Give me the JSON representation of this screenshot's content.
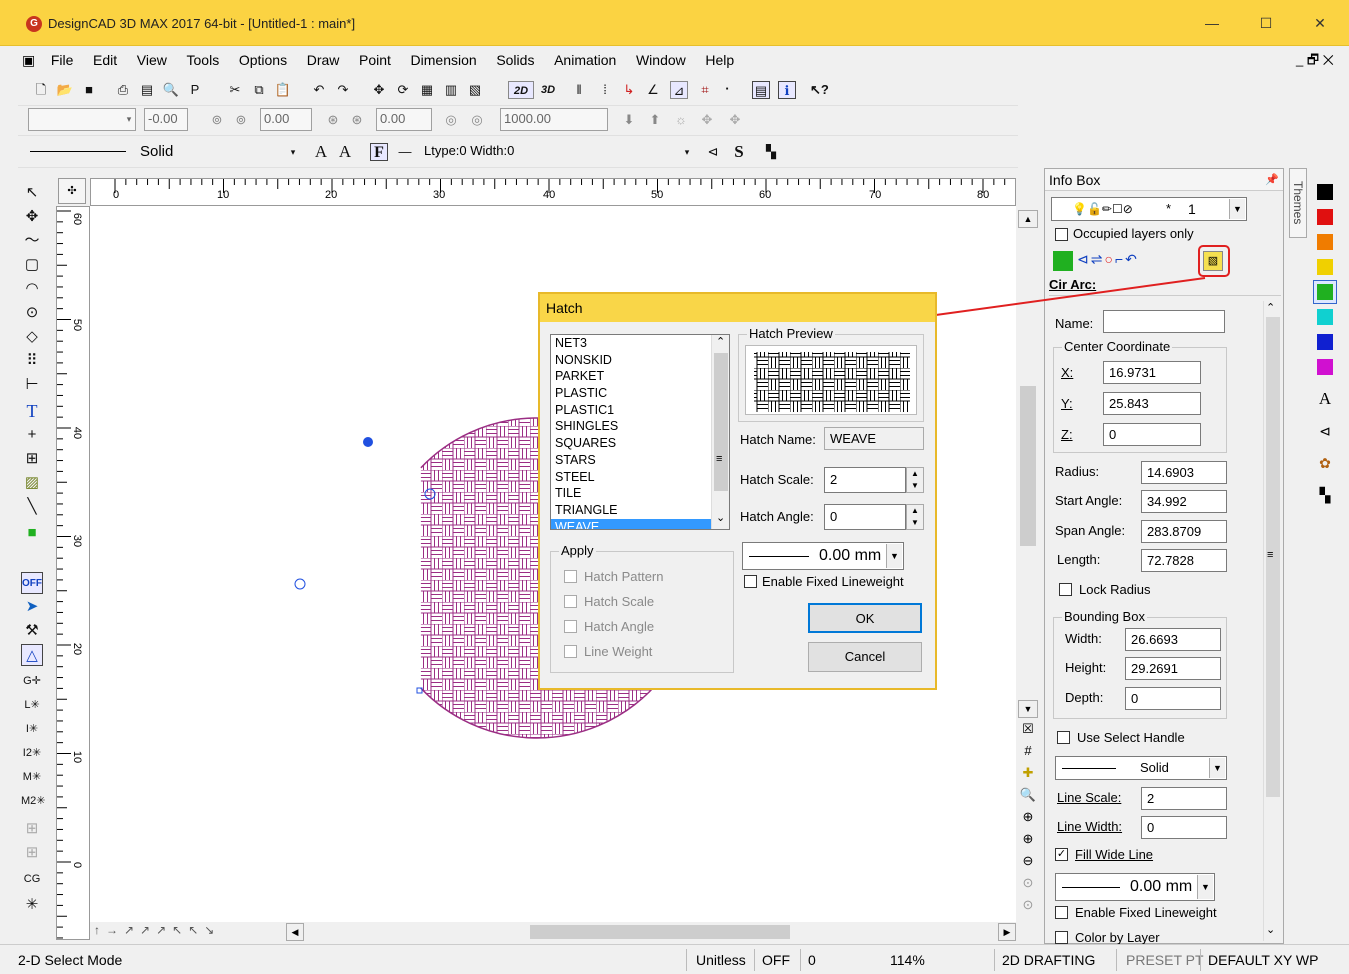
{
  "window": {
    "title": "DesignCAD 3D MAX 2017 64-bit - [Untitled-1 : main*]",
    "app_icon": "designcad-logo-icon",
    "min": "—",
    "max": "☐",
    "close": "✕",
    "mdi_controls": "_ 🗗 ✕"
  },
  "menu": [
    "File",
    "Edit",
    "View",
    "Tools",
    "Options",
    "Draw",
    "Point",
    "Dimension",
    "Solids",
    "Animation",
    "Window",
    "Help"
  ],
  "toolbar2": {
    "f1": "",
    "f2": "-0.00",
    "f3": "0.00",
    "f4": "0.00",
    "f5": "1000.00"
  },
  "toolbar3": {
    "line_label": "Solid",
    "ltype": "Ltype:0  Width:0"
  },
  "ruler": {
    "h_ticks": [
      "0",
      "10",
      "20",
      "30",
      "40",
      "50",
      "60",
      "70",
      "80"
    ],
    "v_ticks": [
      "60",
      "50",
      "40",
      "30",
      "20",
      "10",
      "0"
    ]
  },
  "status": {
    "mode": "2-D Select Mode",
    "units": "Unitless",
    "snap": "OFF",
    "value": "0",
    "zoom": "114%",
    "workspace": "2D DRAFTING",
    "preset": "PRESET PT",
    "plane": "DEFAULT XY WP"
  },
  "infobox": {
    "title": "Info Box",
    "pin": "📌",
    "layer_value": "1",
    "layer_star": "*",
    "occupied_label": "Occupied layers only",
    "entity_label": "Cir Arc:",
    "name_label": "Name:",
    "name_value": "",
    "center_label": "Center Coordinate",
    "x_label": "X:",
    "x_value": "16.9731",
    "y_label": "Y:",
    "y_value": "25.843",
    "z_label": "Z:",
    "z_value": "0",
    "radius_label": "Radius:",
    "radius_value": "14.6903",
    "start_label": "Start Angle:",
    "start_value": "34.992",
    "span_label": "Span Angle:",
    "span_value": "283.8709",
    "length_label": "Length:",
    "length_value": "72.7828",
    "lock_label": "Lock Radius",
    "bbox_label": "Bounding Box",
    "width_label": "Width:",
    "width_value": "26.6693",
    "height_label": "Height:",
    "height_value": "29.2691",
    "depth_label": "Depth:",
    "depth_value": "0",
    "select_handle_label": "Use Select Handle",
    "line_style": "Solid",
    "line_scale_label": "Line Scale:",
    "line_scale_value": "2",
    "line_width_label": "Line Width:",
    "line_width_value": "0",
    "fill_wide_label": "Fill Wide Line",
    "lineweight_value": "0.00 mm",
    "fixed_lw_label": "Enable Fixed Lineweight",
    "color_layer_label": "Color by Layer"
  },
  "themes_label": "Themes",
  "palette": [
    "#000000",
    "#e01010",
    "#f07c00",
    "#f0d000",
    "#20b020",
    "#10d0d0",
    "#1020d0",
    "#d010d0"
  ],
  "hatch": {
    "title": "Hatch",
    "patterns": [
      "NET3",
      "NONSKID",
      "PARKET",
      "PLASTIC",
      "PLASTIC1",
      "SHINGLES",
      "SQUARES",
      "STARS",
      "STEEL",
      "TILE",
      "TRIANGLE",
      "WEAVE"
    ],
    "selected": "WEAVE",
    "preview_label": "Hatch Preview",
    "name_label": "Hatch Name:",
    "name_value": "WEAVE",
    "scale_label": "Hatch Scale:",
    "scale_value": "2",
    "angle_label": "Hatch Angle:",
    "angle_value": "0",
    "apply_label": "Apply",
    "apply_items": [
      "Hatch Pattern",
      "Hatch Scale",
      "Hatch Angle",
      "Line Weight"
    ],
    "lineweight": "0.00 mm",
    "fixed_label": "Enable Fixed Lineweight",
    "ok": "OK",
    "cancel": "Cancel"
  },
  "colors": {
    "title_bar": "#fbd342",
    "hatch_color": "#9b2e84",
    "selection": "#3399ff",
    "annotation": "#e02020"
  }
}
